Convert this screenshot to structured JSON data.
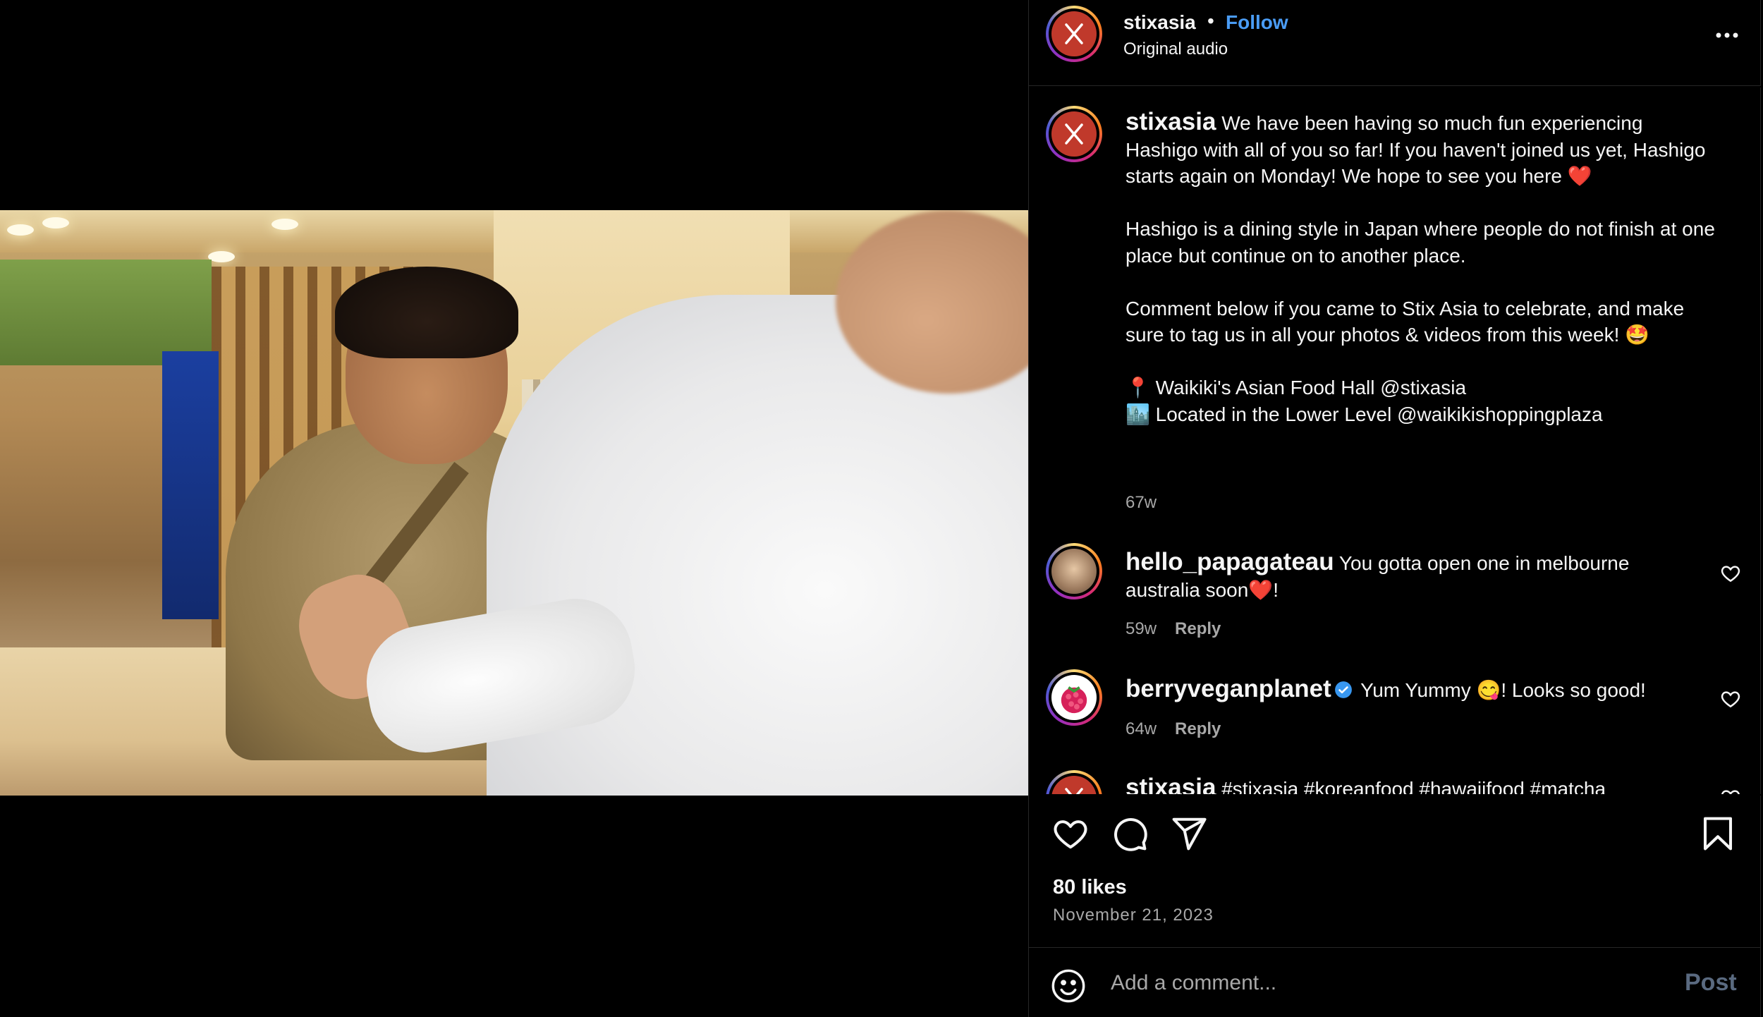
{
  "header": {
    "username": "stixasia",
    "separator": "•",
    "follow_label": "Follow",
    "audio_label": "Original audio"
  },
  "caption": {
    "username": "stixasia",
    "text": "We have been having so much fun experiencing Hashigo with all of you so far! If you haven't joined us yet, Hashigo starts again on Monday! We hope to see you here ❤️\n\nHashigo is a dining style in Japan where people do not finish at one place but continue on to another place.\n\nComment below if you came to Stix Asia to celebrate, and make sure to tag us in all your photos & videos from this week! 🤩\n\n📍 Waikiki's Asian Food Hall @stixasia\n🏙️ Located in the Lower Level @waikikishoppingplaza",
    "age": "67w"
  },
  "comments": [
    {
      "username": "hello_papagateau",
      "text": "You gotta open one in melbourne australia soon❤️!",
      "age": "59w",
      "reply_label": "Reply",
      "verified": false
    },
    {
      "username": "berryveganplanet",
      "text": "Yum Yummy 😋! Looks so good!",
      "age": "64w",
      "reply_label": "Reply",
      "verified": true
    },
    {
      "username": "stixasia",
      "text": "#stixasia #koreanfood #hawaiifood #matcha",
      "verified": false
    }
  ],
  "actions": {
    "likes": "80 likes",
    "date": "November 21, 2023"
  },
  "composer": {
    "placeholder": "Add a comment...",
    "post_label": "Post"
  },
  "icons": [
    "mute-icon",
    "more-icon",
    "heart-icon",
    "comment-icon",
    "share-icon",
    "bookmark-icon",
    "emoji-icon",
    "verified-icon"
  ],
  "colors": {
    "follow": "#4a9cf5",
    "background": "#000000",
    "muted_text": "#a8a8a8",
    "avatar_brand": "#c0392b"
  }
}
